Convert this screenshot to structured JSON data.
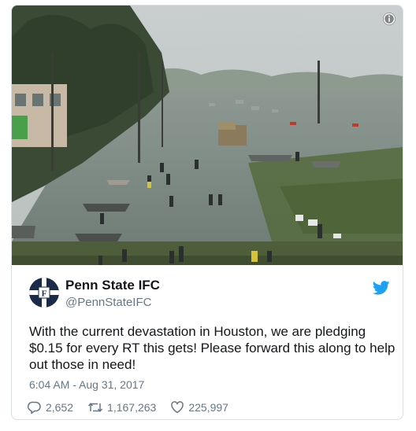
{
  "tweet": {
    "display_name": "Penn State IFC",
    "handle": "@PennStateIFC",
    "text": "With the current devastation in Houston, we are pledging $0.15 for every RT this gets! Please forward this along to help out those in need!",
    "timestamp": "6:04 AM - Aug 31, 2017",
    "avatar_letter": "F"
  },
  "actions": {
    "replies": "2,652",
    "retweets": "1,167,263",
    "likes": "225,997"
  },
  "icons": {
    "info": "info-icon",
    "brand": "twitter-bird-icon",
    "reply": "reply-icon",
    "retweet": "retweet-icon",
    "like": "heart-icon"
  },
  "colors": {
    "twitter_blue": "#1da1f2",
    "text": "#14171a",
    "muted": "#657786",
    "avatar_navy": "#1c2a4a"
  }
}
